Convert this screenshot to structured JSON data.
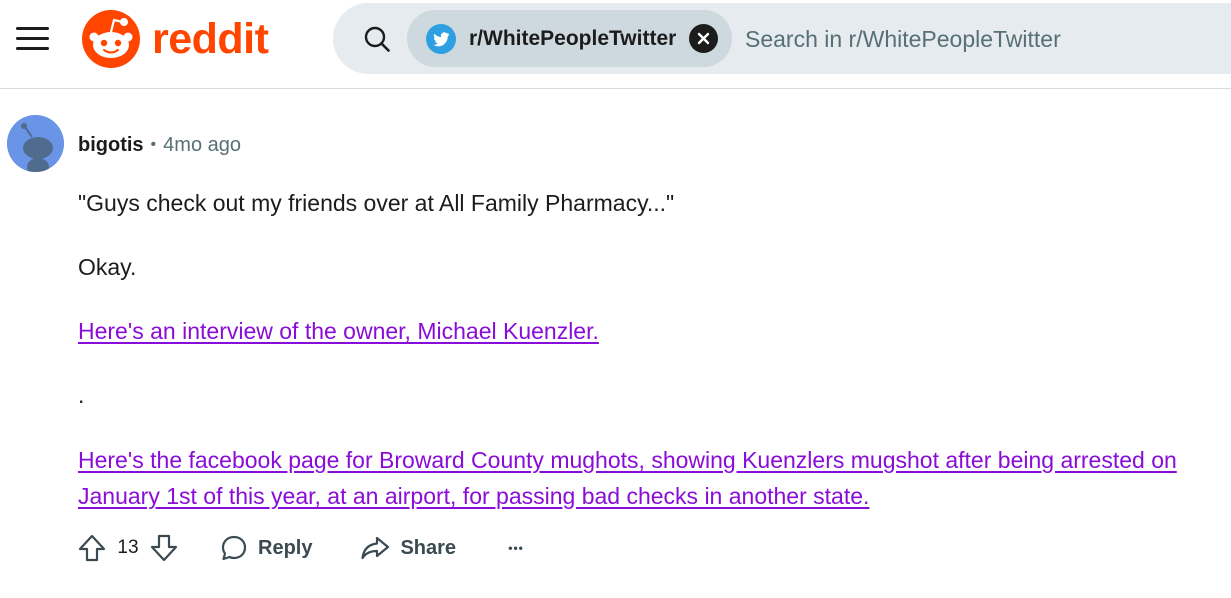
{
  "header": {
    "logo_text": "reddit",
    "community_chip": "r/WhitePeopleTwitter",
    "search_placeholder": "Search in r/WhitePeopleTwitter"
  },
  "comment": {
    "username": "bigotis",
    "separator": "•",
    "timestamp": "4mo ago",
    "paragraphs": [
      "\"Guys check out my friends over at All Family Pharmacy...\"",
      "Okay.",
      "Here's an interview of the owner, Michael Kuenzler.",
      ".",
      "Here's the facebook page for Broward County mughots, showing Kuenzlers mugshot after being arrested on January 1st of this year, at an airport, for passing bad checks in another state."
    ],
    "score": "13",
    "actions": {
      "reply": "Reply",
      "share": "Share",
      "more": "•••"
    }
  },
  "colors": {
    "brand": "#ff4500",
    "link_visited": "#8a0cd8",
    "search_bg": "#e5ebee",
    "chip_bg": "#cdd9df",
    "meta_text": "#576f76"
  },
  "icons": {
    "menu": "hamburger-icon",
    "logo": "reddit-snoo-icon",
    "search": "search-icon",
    "community": "twitter-bird-icon",
    "clear": "close-icon",
    "upvote": "upvote-arrow-icon",
    "downvote": "downvote-arrow-icon",
    "reply": "speech-bubble-icon",
    "share": "share-arrow-icon",
    "more": "ellipsis-icon"
  }
}
